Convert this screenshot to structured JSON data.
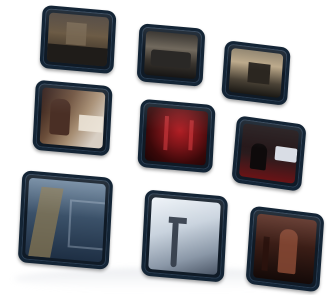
{
  "gallery": {
    "tiles": [
      {
        "icon": "photo-thumbnail",
        "colors": {
          "frame": "#0f1a26",
          "base": "#5a4a35",
          "accent": "#8a7356",
          "shade": "#1c1a18"
        }
      },
      {
        "icon": "photo-thumbnail",
        "colors": {
          "frame": "#0f1a26",
          "base": "#3e3a33",
          "accent": "#8e8574",
          "shade": "#151515"
        }
      },
      {
        "icon": "photo-thumbnail",
        "colors": {
          "frame": "#0f1a26",
          "base": "#6f6148",
          "accent": "#bca98a",
          "shade": "#1a1814"
        }
      },
      {
        "icon": "photo-thumbnail",
        "colors": {
          "frame": "#0f1a26",
          "base": "#6b4e3a",
          "accent": "#cfc2b3",
          "shade": "#1a1010"
        }
      },
      {
        "icon": "photo-thumbnail",
        "colors": {
          "frame": "#0f1a26",
          "base": "#5c0d10",
          "accent": "#b01e24",
          "shade": "#1b0506"
        }
      },
      {
        "icon": "photo-thumbnail",
        "colors": {
          "frame": "#0f1a26",
          "base": "#1b1214",
          "accent": "#d9dde5",
          "shade": "#6a1316"
        }
      },
      {
        "icon": "photo-thumbnail",
        "colors": {
          "frame": "#0f1a26",
          "base": "#1e2f44",
          "accent": "#8fa5bd",
          "shade": "#6b5a36"
        }
      },
      {
        "icon": "photo-thumbnail",
        "colors": {
          "frame": "#0f1a26",
          "base": "#b9c3cf",
          "accent": "#e8edf2",
          "shade": "#4a5565"
        }
      },
      {
        "icon": "photo-thumbnail",
        "colors": {
          "frame": "#0f1a26",
          "base": "#3a1d16",
          "accent": "#8a4a35",
          "shade": "#140a08"
        }
      }
    ]
  }
}
